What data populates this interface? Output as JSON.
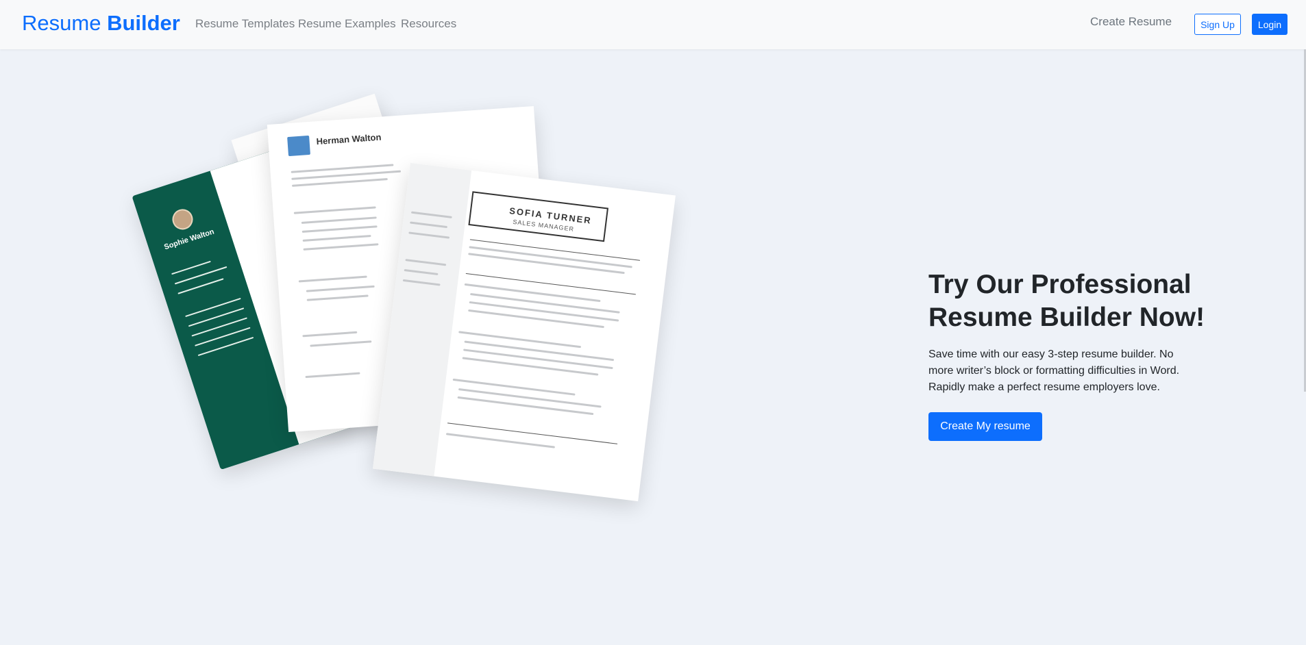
{
  "navbar": {
    "brand_regular": "Resume",
    "brand_bold": "Builder",
    "links": [
      "Resume Templates",
      "Resume Examples",
      "Resources"
    ],
    "create_resume": "Create Resume",
    "signup": "Sign Up",
    "login": "Login"
  },
  "illustration": {
    "resume_1_name": "Sophie Walton",
    "resume_2_name": "Herman Walton",
    "resume_3_name": "SOFIA TURNER",
    "resume_3_subtitle": "SALES MANAGER"
  },
  "hero": {
    "title": "Try Our Professional Resume Builder Now!",
    "subtitle": "Save time with our easy 3-step resume builder. No more writer’s block or formatting difficulties in Word. Rapidly make a perfect resume employers love.",
    "cta": "Create My resume"
  },
  "colors": {
    "primary": "#0d6efd",
    "navbar_bg": "#f8f9fa",
    "page_bg": "#eef2f8",
    "resume_green": "#0b5a49"
  }
}
